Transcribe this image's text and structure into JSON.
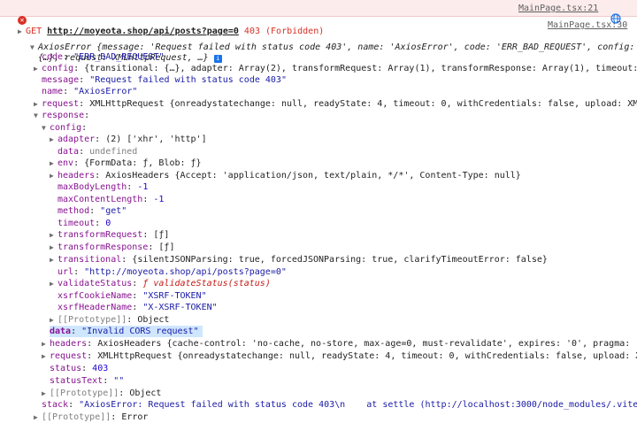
{
  "error_row": {
    "method_label": "GET",
    "url": "http://moyeota.shop/api/posts?page=0",
    "status": "403 (Forbidden)",
    "source_link": "MainPage.tsx:21"
  },
  "source_link_2": "MainPage.tsx:30",
  "summary": {
    "class": "AxiosError",
    "line1": "{message: 'Request failed with status code 403', name: 'AxiosError', code: 'ERR_BAD_REQUEST', config:",
    "line2": "{…}, request: XMLHttpRequest, …}"
  },
  "top": {
    "code": "\"ERR_BAD_REQUEST\"",
    "config": "{transitional: {…}, adapter: Array(2), transformRequest: Array(1), transformResponse: Array(1), timeout: 0,",
    "message": "\"Request failed with status code 403\"",
    "name": "\"AxiosError\"",
    "request": "XMLHttpRequest {onreadystatechange: null, readyState: 4, timeout: 0, withCredentials: false, upload: XMLHt"
  },
  "response_config": {
    "adapter": "(2) ['xhr', 'http']",
    "data": "undefined",
    "env": "{FormData: ƒ, Blob: ƒ}",
    "headers": "AxiosHeaders {Accept: 'application/json, text/plain, */*', Content-Type: null}",
    "maxBodyLength": "-1",
    "maxContentLength": "-1",
    "method": "\"get\"",
    "timeout": "0",
    "transformRequest": "[ƒ]",
    "transformResponse": "[ƒ]",
    "transitional": "{silentJSONParsing: true, forcedJSONParsing: true, clarifyTimeoutError: false}",
    "url": "\"http://moyeota.shop/api/posts?page=0\"",
    "validateStatus": "ƒ validateStatus(status)",
    "xsrfCookieName": "\"XSRF-TOKEN\"",
    "xsrfHeaderName": "\"X-XSRF-TOKEN\"",
    "prototype": "Object"
  },
  "response": {
    "data": "\"Invalid CORS request\"",
    "headers": "AxiosHeaders {cache-control: 'no-cache, no-store, max-age=0, must-revalidate', expires: '0', pragma: 'no",
    "request": "XMLHttpRequest {onreadystatechange: null, readyState: 4, timeout: 0, withCredentials: false, upload: XML",
    "status": "403",
    "statusText": "\"\"",
    "prototype": "Object"
  },
  "stack": "\"AxiosError: Request failed with status code 403\\n    at settle (http://localhost:3000/node_modules/.vite/de",
  "bottom_prototype": "Error",
  "labels": {
    "code": "code",
    "config": "config",
    "message": "message",
    "name": "name",
    "request": "request",
    "response": "response",
    "adapter": "adapter",
    "data": "data",
    "env": "env",
    "headers": "headers",
    "maxBodyLength": "maxBodyLength",
    "maxContentLength": "maxContentLength",
    "method": "method",
    "timeout": "timeout",
    "transformRequest": "transformRequest",
    "transformResponse": "transformResponse",
    "transitional": "transitional",
    "url": "url",
    "validateStatus": "validateStatus",
    "xsrfCookieName": "xsrfCookieName",
    "xsrfHeaderName": "xsrfHeaderName",
    "prototype": "[[Prototype]]",
    "status": "status",
    "statusText": "statusText",
    "stack": "stack"
  }
}
